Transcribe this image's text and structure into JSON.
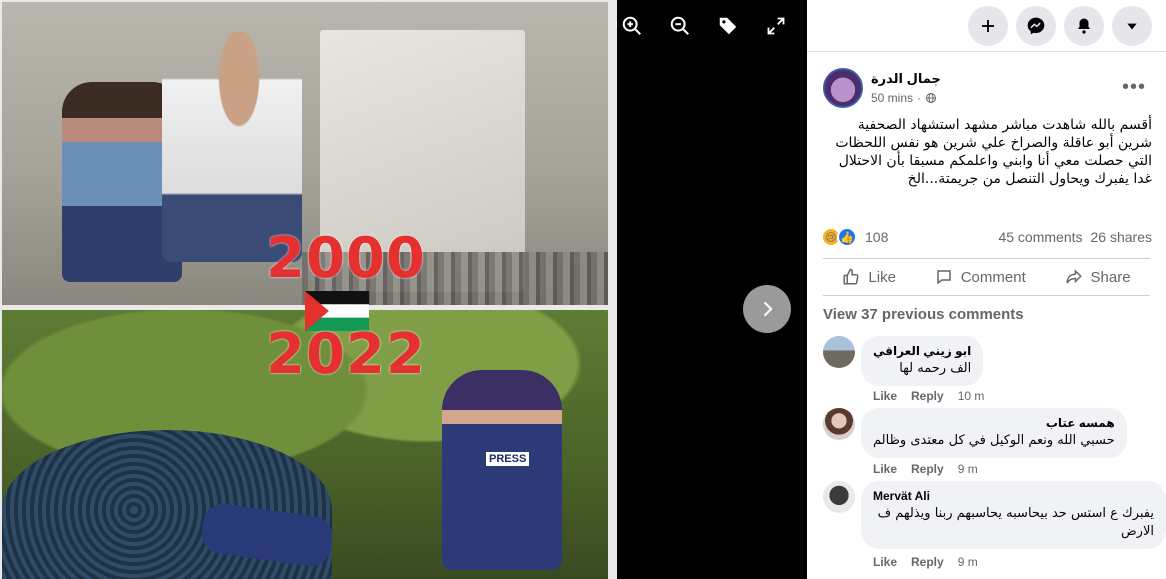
{
  "viewer": {
    "years": [
      "2000",
      "2022"
    ],
    "press_label": "PRESS",
    "tools": [
      "zoom-in-icon",
      "zoom-out-icon",
      "tag-icon",
      "fullscreen-icon"
    ]
  },
  "topbar": {
    "buttons": [
      "plus-icon",
      "messenger-icon",
      "notifications-icon",
      "account-menu-icon"
    ]
  },
  "post": {
    "author": "جمال الدرة",
    "time": "50 mins",
    "privacy_icon": "globe-icon",
    "text": "أقسم بالله شاهدت مباشر مشهد استشهاد الصحفية شرين أبو عاقلة والصراخ علي شرين هو نفس اللحظات التي حصلت معي أنا وابني واعلمكم مسبقا بأن الاحتلال غدا يفبرك ويحاول التنصل من جريمتة...الخ",
    "reaction_count": "108",
    "comments_count": "45 comments",
    "shares_count": "26 shares"
  },
  "actions": {
    "like": "Like",
    "comment": "Comment",
    "share": "Share"
  },
  "view_previous": "View 37 previous comments",
  "comments": [
    {
      "name": "ابو زيني العراقي",
      "text": "الف رحمه لها",
      "like": "Like",
      "reply": "Reply",
      "time": "10 m"
    },
    {
      "name": "همسه عتاب",
      "text": "حسبي الله ونعم الوكيل في كل معتدى وظالم",
      "like": "Like",
      "reply": "Reply",
      "time": "9 m"
    },
    {
      "name": "Mervät Ali",
      "text": "يفبرك ع استس حد بيحاسبه يحاسبهم ربنا ويذلهم ف الارض",
      "like": "Like",
      "reply": "Reply",
      "time": "9 m"
    }
  ],
  "colors": {
    "accent": "#1877f2",
    "year_text": "#e53030",
    "bubble": "#f0f2f5",
    "muted": "#65676b"
  }
}
